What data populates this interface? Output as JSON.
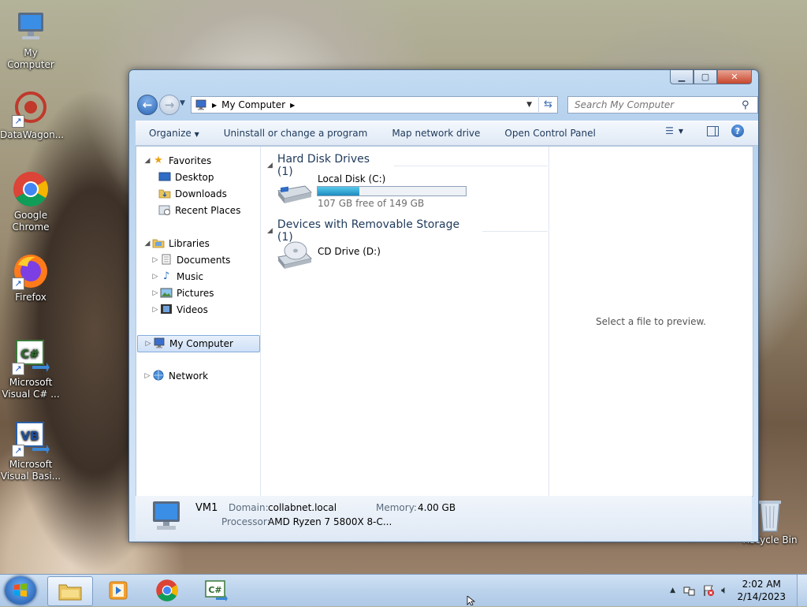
{
  "desktop": {
    "icons": [
      {
        "label": "My Computer"
      },
      {
        "label": "DataWagon..."
      },
      {
        "label": "Google Chrome"
      },
      {
        "label": "Firefox"
      },
      {
        "label": "Microsoft Visual C# ..."
      },
      {
        "label": "Microsoft Visual Basi..."
      },
      {
        "label": "Recycle Bin"
      }
    ]
  },
  "window": {
    "address": {
      "crumb": "My Computer"
    },
    "search": {
      "placeholder": "Search My Computer"
    },
    "toolbar": {
      "organize": "Organize",
      "uninstall": "Uninstall or change a program",
      "map_drive": "Map network drive",
      "control_panel": "Open Control Panel"
    },
    "nav": {
      "favorites": "Favorites",
      "desktop": "Desktop",
      "downloads": "Downloads",
      "recent": "Recent Places",
      "libraries": "Libraries",
      "documents": "Documents",
      "music": "Music",
      "pictures": "Pictures",
      "videos": "Videos",
      "computer": "My Computer",
      "network": "Network"
    },
    "groups": {
      "hdd_header": "Hard Disk Drives (1)",
      "removable_header": "Devices with Removable Storage (1)"
    },
    "drives": {
      "c": {
        "name": "Local Disk (C:)",
        "free_text": "107 GB free of 149 GB",
        "used_fraction": 0.282
      },
      "d": {
        "name": "CD Drive (D:)"
      }
    },
    "preview_text": "Select a file to preview.",
    "details": {
      "computer_name": "VM1",
      "domain_label": "Domain:",
      "domain_value": "collabnet.local",
      "memory_label": "Memory:",
      "memory_value": "4.00 GB",
      "processor_label": "Processor:",
      "processor_value": "AMD Ryzen 7 5800X 8-C..."
    }
  },
  "taskbar": {
    "time": "2:02 AM",
    "date": "2/14/2023"
  },
  "colors": {
    "accent": "#1e395b",
    "progress": "#2aa9d8"
  }
}
